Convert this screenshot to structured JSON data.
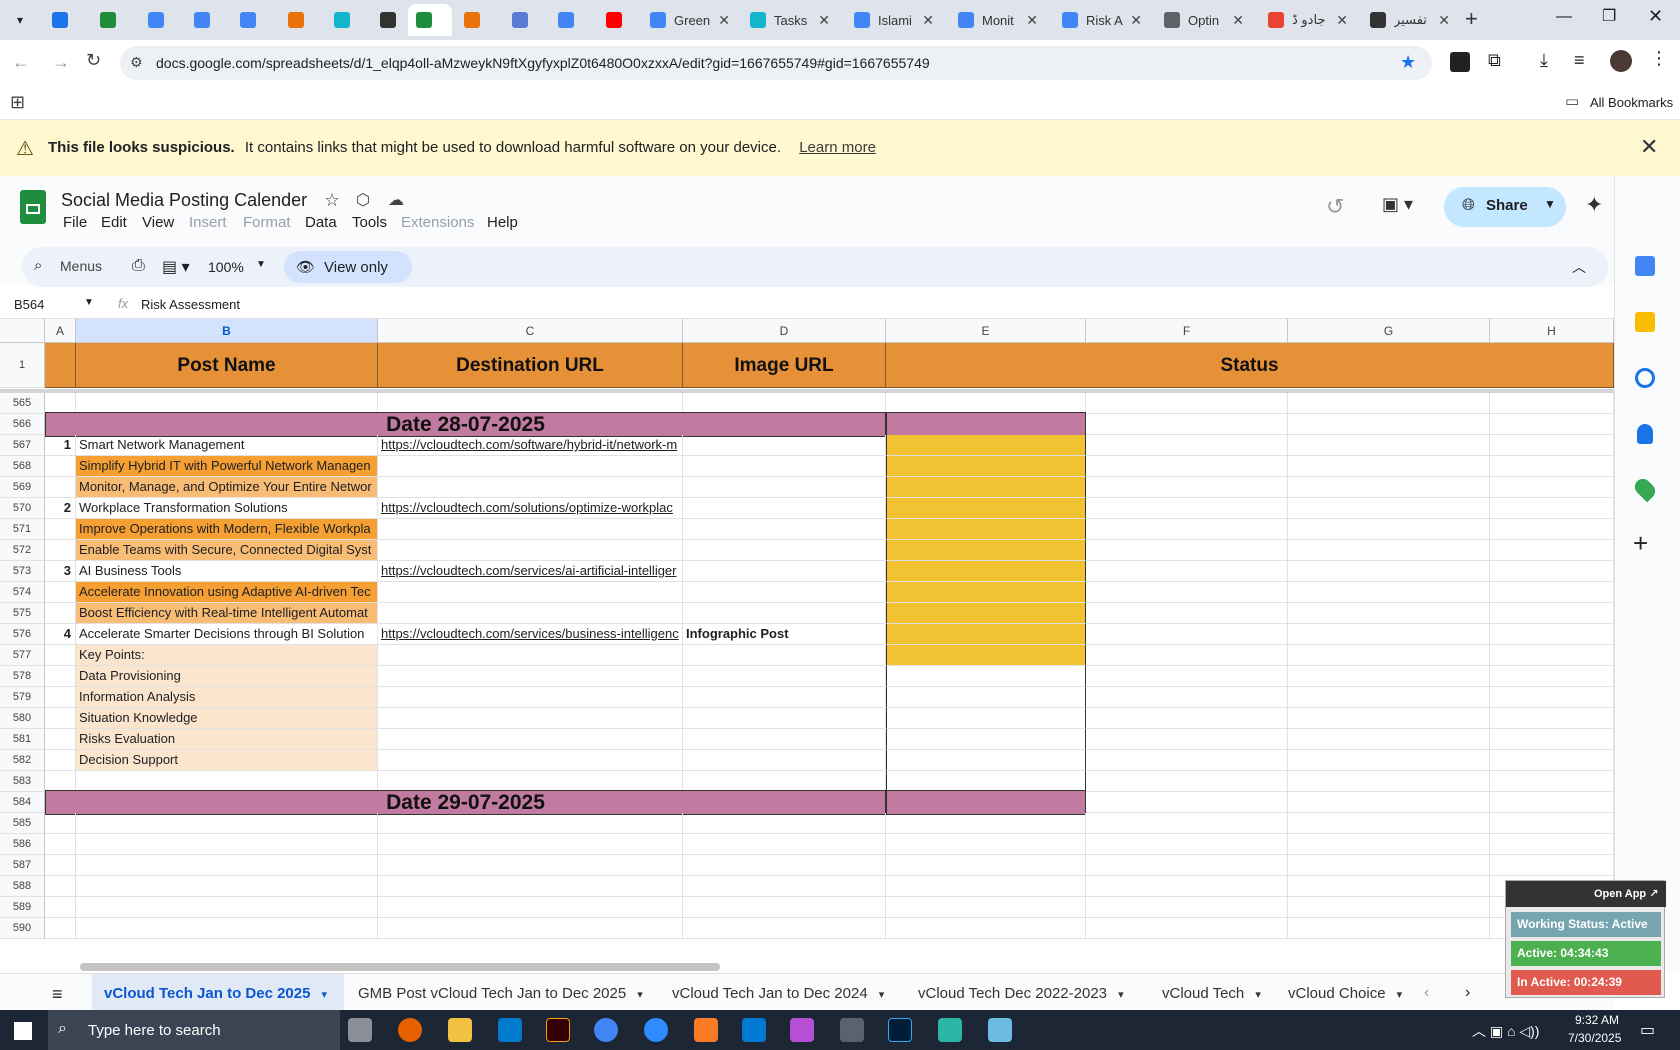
{
  "browser": {
    "tabs": [
      {
        "label": "",
        "color": "#1a73e8"
      },
      {
        "label": "",
        "color": "#1e8e3e"
      },
      {
        "label": "",
        "color": "#4285f4"
      },
      {
        "label": "",
        "color": "#4285f4"
      },
      {
        "label": "",
        "color": "#4285f4"
      },
      {
        "label": "",
        "color": "#e8710a"
      },
      {
        "label": "",
        "color": "#12b5cb"
      },
      {
        "label": "",
        "color": "#333333"
      },
      {
        "label": "",
        "color": "#1e8e3e"
      },
      {
        "label": "",
        "color": "#e8710a"
      },
      {
        "label": "",
        "color": "#5b7bd5"
      },
      {
        "label": "",
        "color": "#4285f4"
      },
      {
        "label": "",
        "color": "#ff0000"
      },
      {
        "label": "Green",
        "color": "#4285f4"
      },
      {
        "label": "Tasks",
        "color": "#12b5cb"
      },
      {
        "label": "Islami",
        "color": "#4285f4"
      },
      {
        "label": "Monit",
        "color": "#4285f4"
      },
      {
        "label": "Risk A",
        "color": "#4285f4"
      },
      {
        "label": "Optin",
        "color": "#5f6368"
      },
      {
        "label": "جادو ڈ",
        "color": "#ea4335"
      },
      {
        "label": "تفسير",
        "color": "#333333"
      }
    ],
    "url": "docs.google.com/spreadsheets/d/1_elqp4oll-aMzweykN9ftXgyfyxplZ0t6480O0xzxxA/edit?gid=1667655749#gid=1667655749",
    "bookmarks_label": "All Bookmarks"
  },
  "warning": {
    "bold": "This file looks suspicious.",
    "text": "It contains links that might be used to download harmful software on your device.",
    "link": "Learn more"
  },
  "doc": {
    "title": "Social Media Posting Calender",
    "menus": [
      "File",
      "Edit",
      "View",
      "Insert",
      "Format",
      "Data",
      "Tools",
      "Extensions",
      "Help"
    ],
    "share_label": "Share",
    "search_label": "Menus",
    "zoom": "100%",
    "view_only": "View only",
    "cell_ref": "B564",
    "formula": "Risk Assessment"
  },
  "sheet": {
    "columns": [
      "A",
      "B",
      "C",
      "D",
      "E",
      "F",
      "G",
      "H"
    ],
    "header_row_num": "1",
    "headers": {
      "post_name": "Post Name",
      "destination_url": "Destination URL",
      "image_url": "Image URL",
      "status": "Status"
    },
    "rows": [
      {
        "num": "565",
        "type": "blank"
      },
      {
        "num": "566",
        "type": "date",
        "label": "Date 28-07-2025"
      },
      {
        "num": "567",
        "type": "post",
        "a": "1",
        "b": "Smart Network Management",
        "c": "https://vcloudtech.com/software/hybrid-it/network-m",
        "d": ""
      },
      {
        "num": "568",
        "type": "orange",
        "b": "Simplify Hybrid IT with Powerful Network Managen"
      },
      {
        "num": "569",
        "type": "lightorange",
        "b": "Monitor, Manage, and Optimize Your Entire Networ"
      },
      {
        "num": "570",
        "type": "post",
        "a": "2",
        "b": "Workplace Transformation Solutions",
        "c": "https://vcloudtech.com/solutions/optimize-workplac",
        "d": ""
      },
      {
        "num": "571",
        "type": "orange",
        "b": "Improve Operations with Modern, Flexible Workpla"
      },
      {
        "num": "572",
        "type": "lightorange",
        "b": "Enable Teams with Secure, Connected Digital Syst"
      },
      {
        "num": "573",
        "type": "post",
        "a": "3",
        "b": "AI Business Tools",
        "c": "https://vcloudtech.com/services/ai-artificial-intelliger",
        "d": ""
      },
      {
        "num": "574",
        "type": "orange",
        "b": "Accelerate Innovation using Adaptive AI-driven Tec"
      },
      {
        "num": "575",
        "type": "lightorange",
        "b": "Boost Efficiency with Real-time Intelligent Automat"
      },
      {
        "num": "576",
        "type": "post",
        "a": "4",
        "b": "Accelerate Smarter Decisions through BI Solution",
        "c": "https://vcloudtech.com/services/business-intelligenc",
        "d": "Infographic Post"
      },
      {
        "num": "577",
        "type": "peach",
        "b": "Key Points:"
      },
      {
        "num": "578",
        "type": "peach",
        "b": "Data Provisioning"
      },
      {
        "num": "579",
        "type": "peach",
        "b": "Information Analysis"
      },
      {
        "num": "580",
        "type": "peach",
        "b": "Situation Knowledge"
      },
      {
        "num": "581",
        "type": "peach",
        "b": "Risks Evaluation"
      },
      {
        "num": "582",
        "type": "peach",
        "b": "Decision Support"
      },
      {
        "num": "583",
        "type": "blank"
      },
      {
        "num": "584",
        "type": "date",
        "label": "Date 29-07-2025"
      },
      {
        "num": "585",
        "type": "blank"
      },
      {
        "num": "586",
        "type": "blank"
      },
      {
        "num": "587",
        "type": "blank"
      },
      {
        "num": "588",
        "type": "blank"
      },
      {
        "num": "589",
        "type": "blank"
      },
      {
        "num": "590",
        "type": "blank"
      }
    ],
    "colors": {
      "header_orange": "#e69138",
      "date_purple": "#c27ba0",
      "row_orange": "#f6a033",
      "row_lightorange": "#f9bc74",
      "row_peach": "#fce5cd",
      "status_yellow": "#f1c232"
    }
  },
  "sheet_tabs": [
    {
      "label": "vCloud Tech Jan to Dec 2025",
      "active": true
    },
    {
      "label": "GMB Post vCloud Tech Jan to Dec 2025"
    },
    {
      "label": "vCloud Tech Jan to Dec 2024"
    },
    {
      "label": "vCloud Tech Dec 2022-2023"
    },
    {
      "label": "vCloud Tech"
    },
    {
      "label": "vCloud Choice"
    }
  ],
  "widget": {
    "open_app": "Open App ↗",
    "working_status": "Working Status: Active",
    "active": "Active: 04:34:43",
    "inactive": "In Active: 00:24:39"
  },
  "taskbar": {
    "search_placeholder": "Type here to search",
    "time": "9:32 AM",
    "date": "7/30/2025"
  }
}
